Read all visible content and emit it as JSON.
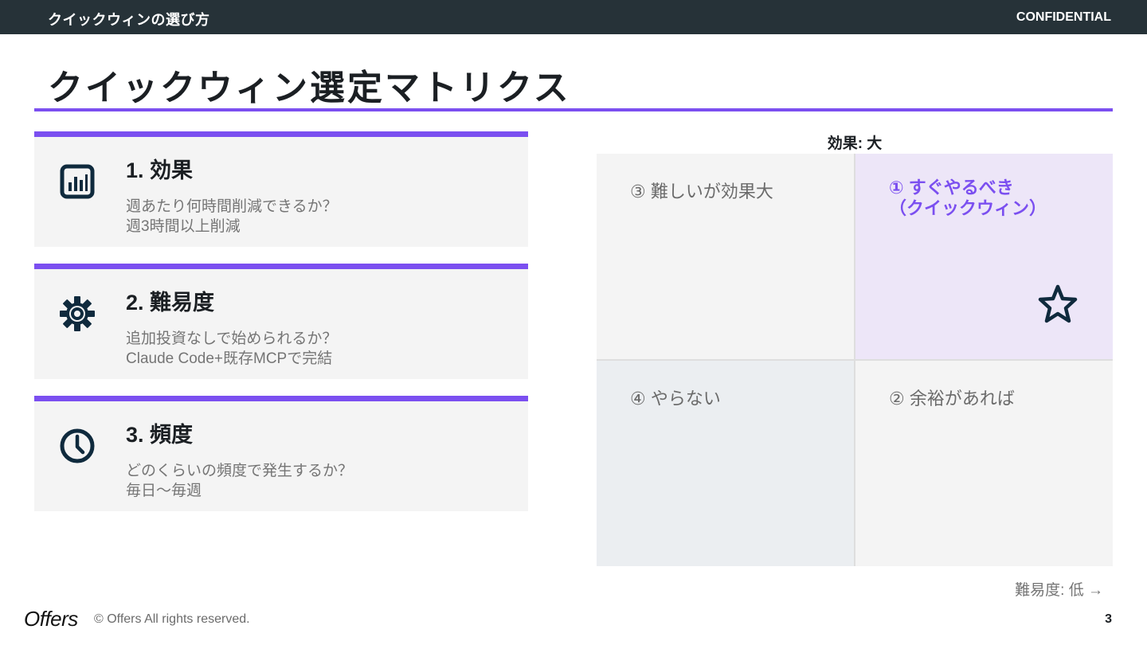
{
  "header": {
    "section_title": "クイックウィンの選び方",
    "confidential": "CONFIDENTIAL"
  },
  "page_title": "クイックウィン選定マトリクス",
  "criteria": [
    {
      "heading": "1. 効果",
      "line1": "週あたり何時間削減できるか？",
      "line2": "週3時間以上削減",
      "icon": "bar-chart-icon"
    },
    {
      "heading": "2. 難易度",
      "line1": "追加投資なしで始められるか？",
      "line2": "Claude Code+既存MCPで完結",
      "icon": "gear-icon"
    },
    {
      "heading": "3. 頻度",
      "line1": "どのくらいの頻度で発生するか？",
      "line2": "毎日〜毎週",
      "icon": "clock-icon"
    }
  ],
  "matrix": {
    "top_label": "効果: 大",
    "bottom_label": "難易度: 低 →",
    "quadrants": {
      "q1": {
        "line1": "① すぐやるべき",
        "line2": "（クイックウィン）",
        "color": "#7b4ff0",
        "bg": "#ede6f8"
      },
      "q2": {
        "label": "② 余裕があれば",
        "bg": "#f4f4f4"
      },
      "q3": {
        "label": "③ 難しいが効果大",
        "bg": "#f4f4f4"
      },
      "q4": {
        "label": "④ やらない",
        "bg": "#ebeef1"
      }
    }
  },
  "footer": {
    "logo": "Offers",
    "copyright": "© Offers All rights reserved.",
    "page_number": "3"
  },
  "colors": {
    "accent": "#7b4ff0",
    "header_bg": "#263238",
    "card_bg": "#f4f4f4",
    "icon": "#0f2a3d"
  }
}
